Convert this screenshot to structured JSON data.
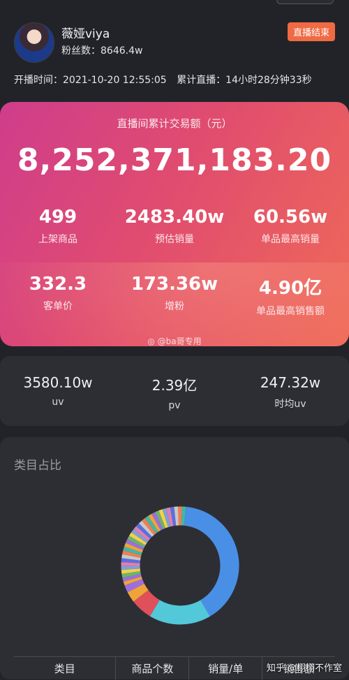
{
  "profile": {
    "name": "薇娅viya",
    "fans": "粉丝数：8646.4w",
    "status": "直播结束"
  },
  "meta": {
    "start": "开播时间：2021-10-20 12:55:05",
    "duration": "累计直播：14小时28分钟33秒"
  },
  "hero": {
    "label": "直播间累计交易额（元）",
    "value": "8,252,371,183.20",
    "stats": [
      {
        "value": "499",
        "label": "上架商品"
      },
      {
        "value": "2483.40w",
        "label": "预估销量"
      },
      {
        "value": "60.56w",
        "label": "单品最高销量"
      },
      {
        "value": "332.3",
        "label": "客单价"
      },
      {
        "value": "173.36w",
        "label": "增粉"
      },
      {
        "value": "4.90亿",
        "label": "单品最高销售额"
      }
    ],
    "watermark": "@ba哥专用"
  },
  "traffic": [
    {
      "value": "3580.10w",
      "label": "uv"
    },
    {
      "value": "2.39亿",
      "label": "pv"
    },
    {
      "value": "247.32w",
      "label": "时均uv"
    }
  ],
  "category": {
    "title": "类目占比",
    "colors": {
      "primary": "#4a8fe6",
      "secondary": "#53c8d8",
      "accent": "#e0505a",
      "misc": [
        "#f0a33a",
        "#9b6fdc",
        "#6fb36a",
        "#f2d14a",
        "#7fa0d8",
        "#e07fb0",
        "#5a6fe0",
        "#c8c8c8",
        "#f07e52",
        "#3fb8a8"
      ]
    },
    "columns": [
      "类目",
      "商品个数",
      "销量/单",
      "销售额"
    ]
  },
  "corner_watermark": "知乎 @栩栩不作室"
}
